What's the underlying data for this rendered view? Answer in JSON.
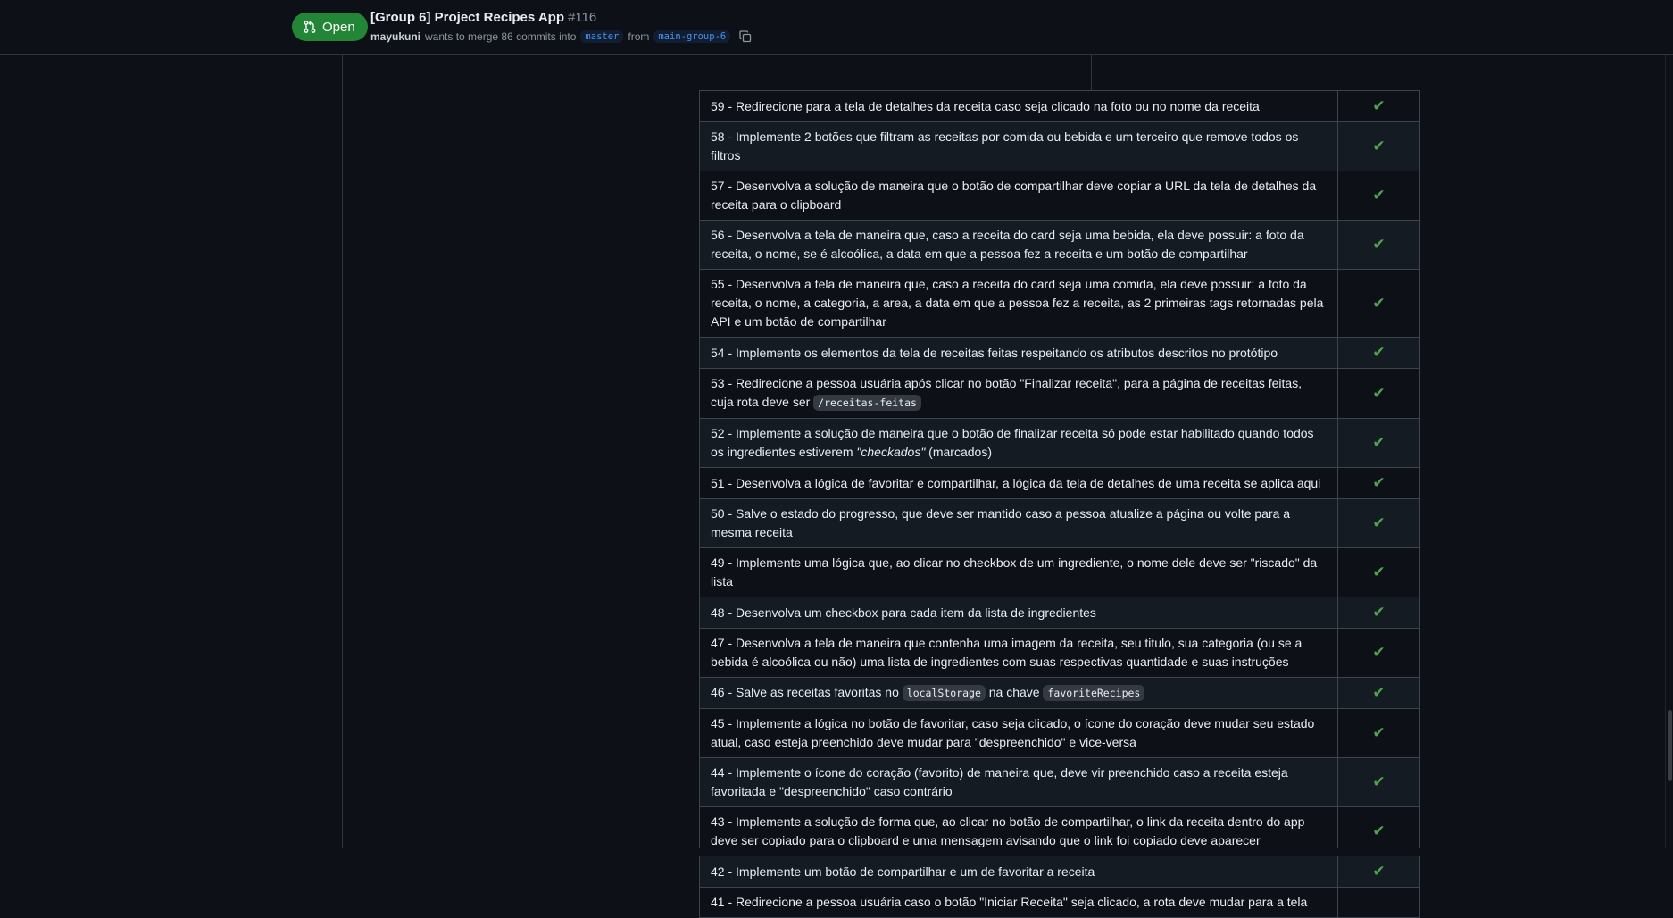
{
  "header": {
    "state": "Open",
    "title": "[Group 6] Project Recipes App",
    "number": "#116",
    "author": "mayukuni",
    "merge_text": "wants to merge 86 commits into",
    "base_branch": "master",
    "from_text": "from",
    "head_branch": "main-group-6",
    "state_color": "#238636"
  },
  "rows": [
    {
      "text": "59 - Redirecione para a tela de detalhes da receita caso seja clicado na foto ou no nome da receita",
      "status": "✔"
    },
    {
      "text": "58 - Implemente 2 botões que filtram as receitas por comida ou bebida e um terceiro que remove todos os filtros",
      "status": "✔"
    },
    {
      "text": "57 - Desenvolva a solução de maneira que o botão de compartilhar deve copiar a URL da tela de detalhes da receita para o clipboard",
      "status": "✔"
    },
    {
      "text": "56 - Desenvolva a tela de maneira que, caso a receita do card seja uma bebida, ela deve possuir: a foto da receita, o nome, se é alcoólica, a data em que a pessoa fez a receita e um botão de compartilhar",
      "status": "✔"
    },
    {
      "text": "55 - Desenvolva a tela de maneira que, caso a receita do card seja uma comida, ela deve possuir: a foto da receita, o nome, a categoria, a area, a data em que a pessoa fez a receita, as 2 primeiras tags retornadas pela API e um botão de compartilhar",
      "status": "✔"
    },
    {
      "text": "54 - Implemente os elementos da tela de receitas feitas respeitando os atributos descritos no protótipo",
      "status": "✔"
    },
    {
      "text_before": "53 - Redirecione a pessoa usuária após clicar no botão \"Finalizar receita\", para a página de receitas feitas, cuja rota deve ser ",
      "code": "/receitas-feitas",
      "status": "✔"
    },
    {
      "text_before": "52 - Implemente a solução de maneira que o botão de finalizar receita só pode estar habilitado quando todos os ingredientes estiverem ",
      "emphasis": "\"checkados\"",
      "text_after": " (marcados)",
      "status": "✔"
    },
    {
      "text": "51 - Desenvolva a lógica de favoritar e compartilhar, a lógica da tela de detalhes de uma receita se aplica aqui",
      "status": "✔"
    },
    {
      "text": "50 - Salve o estado do progresso, que deve ser mantido caso a pessoa atualize a página ou volte para a mesma receita",
      "status": "✔"
    },
    {
      "text": "49 - Implemente uma lógica que, ao clicar no checkbox de um ingrediente, o nome dele deve ser \"riscado\" da lista",
      "status": "✔"
    },
    {
      "text": "48 - Desenvolva um checkbox para cada item da lista de ingredientes",
      "status": "✔"
    },
    {
      "text": "47 - Desenvolva a tela de maneira que contenha uma imagem da receita, seu titulo, sua categoria (ou se a bebida é alcoólica ou não) uma lista de ingredientes com suas respectivas quantidade e suas instruções",
      "status": "✔"
    },
    {
      "text_before": "46 - Salve as receitas favoritas no ",
      "code": "localStorage",
      "text_mid": " na chave ",
      "code2": "favoriteRecipes",
      "status": "✔"
    },
    {
      "text": "45 - Implemente a lógica no botão de favoritar, caso seja clicado, o ícone do coração deve mudar seu estado atual, caso esteja preenchido deve mudar para \"despreenchido\" e vice-versa",
      "status": "✔"
    },
    {
      "text": "44 - Implemente o ícone do coração (favorito) de maneira que, deve vir preenchido caso a receita esteja favoritada e \"despreenchido\" caso contrário",
      "status": "✔"
    },
    {
      "text": "43 - Implemente a solução de forma que, ao clicar no botão de compartilhar, o link da receita dentro do app deve ser copiado para o clipboard e uma mensagem avisando que o link foi copiado deve aparecer",
      "status": "✔"
    },
    {
      "text": "42 - Implemente um botão de compartilhar e um de favoritar a receita",
      "status": "✔"
    },
    {
      "text": "41 - Redirecione a pessoa usuária caso o botão \"Iniciar Receita\" seja clicado, a rota deve mudar para a tela",
      "status": ""
    }
  ]
}
